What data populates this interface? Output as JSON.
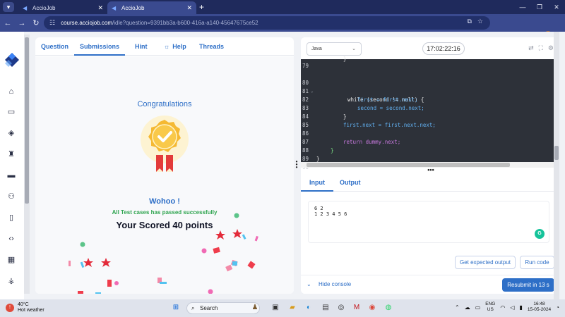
{
  "browser": {
    "tabs": [
      {
        "title": "AccioJob",
        "active": false
      },
      {
        "title": "AccioJob",
        "active": true
      }
    ],
    "new_tab": "+",
    "url_host": "course.acciojob.com",
    "url_path": "/idle?question=9391bb3a-b600-416a-a140-45647675ce52"
  },
  "left_panel": {
    "tabs": [
      {
        "label": "Question",
        "active": false
      },
      {
        "label": "Submissions",
        "active": true
      },
      {
        "label": "Hint",
        "active": false
      },
      {
        "label": "Help",
        "active": false
      },
      {
        "label": "Threads",
        "active": false
      }
    ],
    "congrats": "Congratulations",
    "wohoo": "Wohoo !",
    "passed_message": "All Test cases has passed successfully",
    "score_text": "Your Scored 40 points"
  },
  "right_panel": {
    "language": "Java",
    "timer": "17:02:22:16",
    "code_lines": [
      {
        "n": "79",
        "text": ""
      },
      {
        "n": "80",
        "text": "while (second != null) {"
      },
      {
        "n": "81",
        "text": "first = first.next;"
      },
      {
        "n": "82",
        "text": "second = second.next;"
      },
      {
        "n": "83",
        "text": "}"
      },
      {
        "n": "84",
        "text": "first.next = first.next.next;"
      },
      {
        "n": "85",
        "text": ""
      },
      {
        "n": "86",
        "text": "return dummy.next;"
      },
      {
        "n": "87",
        "text": "}"
      },
      {
        "n": "88",
        "text": "}"
      },
      {
        "n": "89",
        "text": ""
      },
      {
        "n": "90",
        "text": ""
      }
    ],
    "io_tabs": [
      {
        "label": "Input",
        "active": true
      },
      {
        "label": "Output",
        "active": false
      }
    ],
    "input_lines": [
      "6 2",
      "1 2 3 4 5 6"
    ],
    "get_expected_output": "Get expected output",
    "run_code": "Run code",
    "hide_console": "Hide console",
    "resubmit": "Resubmit in 13 s"
  },
  "taskbar": {
    "temperature": "40°C",
    "weather": "Hot weather",
    "search_placeholder": "Search",
    "lang_top": "ENG",
    "lang_bottom": "US",
    "time": "16:48",
    "date": "15-05-2024"
  },
  "colors": {
    "accent": "#2e6fc7",
    "success": "#2ea44f",
    "editor_bg": "#2d3139"
  }
}
